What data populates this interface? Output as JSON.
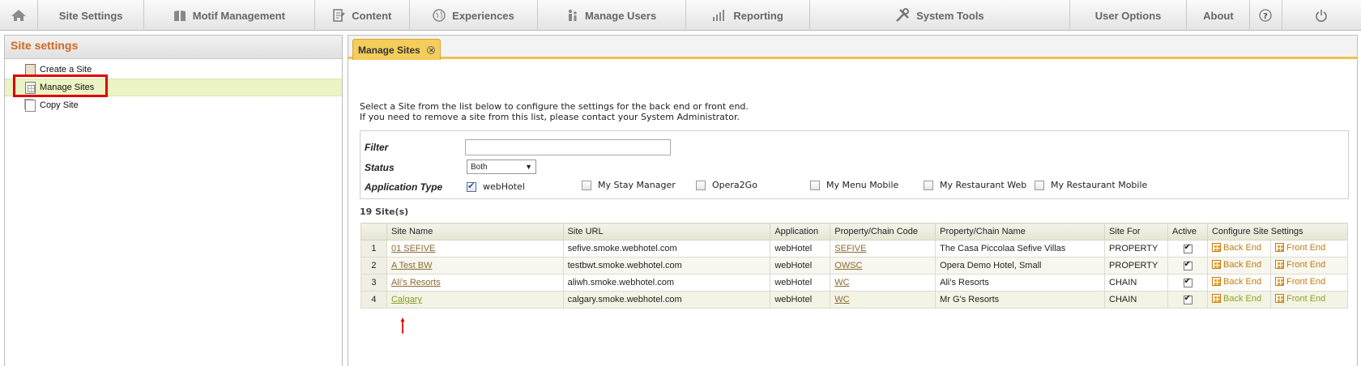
{
  "topnav": {
    "items": [
      {
        "label": "",
        "icon": "home-icon"
      },
      {
        "label": "Site Settings",
        "icon": ""
      },
      {
        "label": "Motif Management",
        "icon": "book-icon"
      },
      {
        "label": "Content",
        "icon": "document-icon"
      },
      {
        "label": "Experiences",
        "icon": "globe-icon"
      },
      {
        "label": "Manage Users",
        "icon": "users-icon"
      },
      {
        "label": "Reporting",
        "icon": "bar-chart-icon"
      },
      {
        "label": "System Tools",
        "icon": "tools-icon"
      },
      {
        "label": "User Options",
        "icon": ""
      },
      {
        "label": "About",
        "icon": ""
      },
      {
        "label": "",
        "icon": "help-icon"
      },
      {
        "label": "",
        "icon": "power-icon"
      }
    ]
  },
  "sidebar": {
    "title": "Site settings",
    "items": [
      {
        "label": "Create a Site",
        "icon": "create-site-icon"
      },
      {
        "label": "Manage Sites",
        "icon": "manage-sites-icon",
        "selected": true
      },
      {
        "label": "Copy Site",
        "icon": "copy-site-icon"
      }
    ]
  },
  "main": {
    "tab_label": "Manage Sites",
    "intro_line1": "Select a Site from the list below to configure the settings for the back end or front end.",
    "intro_line2": "If you need to remove a site from this list, please contact your System Administrator.",
    "filter": {
      "filter_label": "Filter",
      "filter_value": "",
      "status_label": "Status",
      "status_value": "Both",
      "apptype_label": "Application Type",
      "app_types": [
        {
          "label": "webHotel",
          "checked": true
        },
        {
          "label": "My Stay Manager",
          "checked": false
        },
        {
          "label": "Opera2Go",
          "checked": false
        },
        {
          "label": "My Menu Mobile",
          "checked": false
        },
        {
          "label": "My Restaurant Web",
          "checked": false
        },
        {
          "label": "My Restaurant Mobile",
          "checked": false
        }
      ]
    },
    "site_count": "19 Site(s)",
    "table": {
      "columns": [
        "",
        "Site Name",
        "Site URL",
        "Application",
        "Property/Chain Code",
        "Property/Chain Name",
        "Site For",
        "Active",
        "Configure Site Settings"
      ],
      "back_end_label": "Back End",
      "front_end_label": "Front End",
      "rows": [
        {
          "num": "1",
          "name": "01 SEFIVE",
          "url": "sefive.smoke.webhotel.com",
          "app": "webHotel",
          "code": "SEFIVE",
          "chain_name": "The Casa Piccolaa Sefive Villas",
          "site_for": "PROPERTY",
          "active": true
        },
        {
          "num": "2",
          "name": "A Test BW",
          "url": "testbwt.smoke.webhotel.com",
          "app": "webHotel",
          "code": "OWSC",
          "chain_name": "Opera Demo Hotel, Small",
          "site_for": "PROPERTY",
          "active": true
        },
        {
          "num": "3",
          "name": "Ali's Resorts",
          "url": "aliwh.smoke.webhotel.com",
          "app": "webHotel",
          "code": "WC",
          "chain_name": "Ali's Resorts",
          "site_for": "CHAIN",
          "active": true
        },
        {
          "num": "4",
          "name": "Calgary",
          "url": "calgary.smoke.webhotel.com",
          "app": "webHotel",
          "code": "WC",
          "chain_name": "Mr G's Resorts",
          "site_for": "CHAIN",
          "active": true
        }
      ]
    }
  },
  "colors": {
    "accent": "#d2691e",
    "tab": "#f4cd5b",
    "selected_row": "#ecf3c4",
    "annotation": "#e00000"
  }
}
